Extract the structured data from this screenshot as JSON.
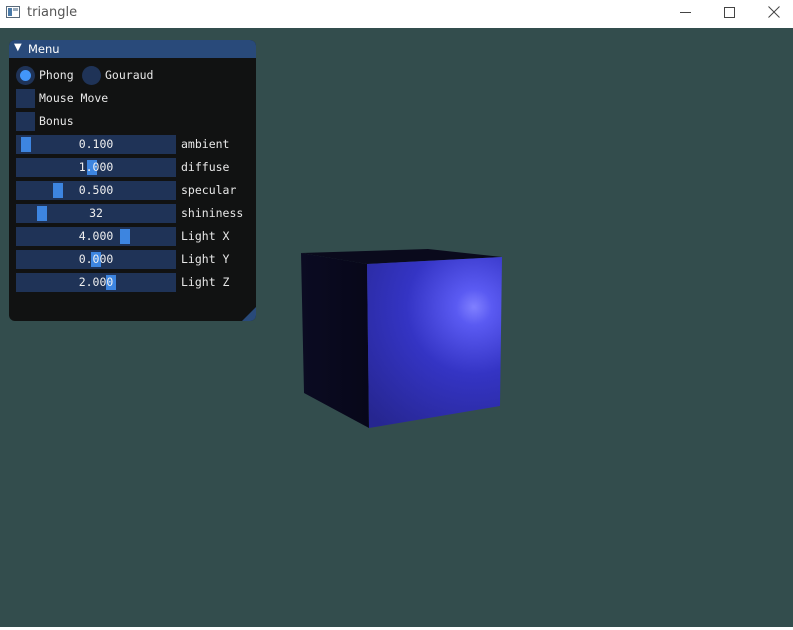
{
  "window": {
    "title": "triangle",
    "buttons": [
      "minimize",
      "maximize",
      "close"
    ]
  },
  "viewport": {
    "background": "#334d4d"
  },
  "menu": {
    "title": "Menu",
    "shading": {
      "options": [
        "Phong",
        "Gouraud"
      ],
      "selected": "Phong"
    },
    "checkboxes": [
      {
        "label": "Mouse Move",
        "checked": false
      },
      {
        "label": "Bonus",
        "checked": false
      }
    ],
    "sliders": [
      {
        "label": "ambient",
        "value": "0.100",
        "fraction": 0.02
      },
      {
        "label": "diffuse",
        "value": "1.000",
        "fraction": 0.47
      },
      {
        "label": "specular",
        "value": "0.500",
        "fraction": 0.24
      },
      {
        "label": "shininess",
        "value": "32",
        "fraction": 0.13
      },
      {
        "label": "Light X",
        "value": "4.000",
        "fraction": 0.7
      },
      {
        "label": "Light Y",
        "value": "0.000",
        "fraction": 0.5
      },
      {
        "label": "Light Z",
        "value": "2.000",
        "fraction": 0.6
      }
    ]
  },
  "colors": {
    "accent": "#4296fa",
    "frame": "#1f3357",
    "title_bar": "#294a7a"
  }
}
